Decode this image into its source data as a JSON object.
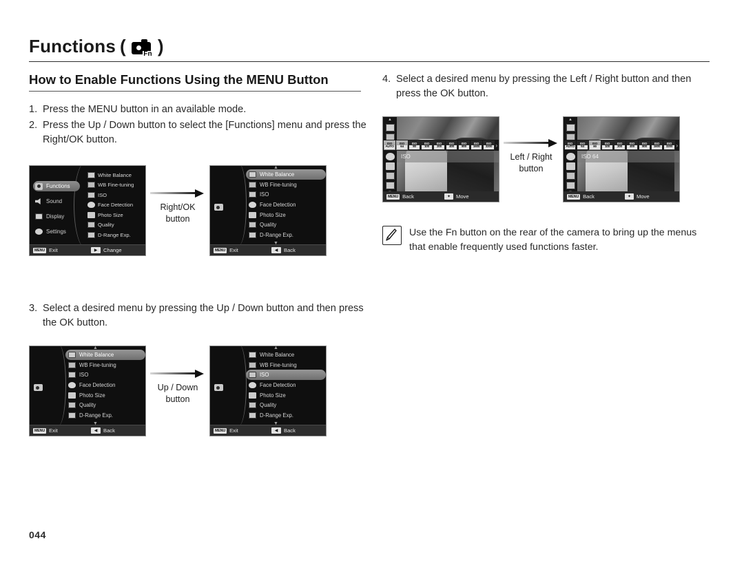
{
  "header": {
    "title": "Functions",
    "paren_open": "(",
    "paren_close": ")",
    "icon": "camera-fn-icon",
    "icon_label": "Fn"
  },
  "section": {
    "title": "How to Enable Functions Using the MENU Button"
  },
  "steps": {
    "s1_num": "1.",
    "s1_text": "Press the MENU button in an available mode.",
    "s2_num": "2.",
    "s2_text": "Press the Up / Down button to select the [Functions] menu and press the Right/OK button.",
    "s3_num": "3.",
    "s3_text": "Select a desired menu by pressing the Up / Down button and then press the OK button.",
    "s4_num": "4.",
    "s4_text": "Select a desired menu by pressing the Left / Right button and then press the OK button."
  },
  "connectors": {
    "c1_line1": "Right/OK",
    "c1_line2": "button",
    "c2_line1": "Up / Down",
    "c2_line2": "button",
    "c3_line1": "Left / Right",
    "c3_line2": "button"
  },
  "menu_categories": [
    {
      "label": "Functions",
      "icon": "camera-icon",
      "selected": true
    },
    {
      "label": "Sound",
      "icon": "speaker-icon",
      "selected": false
    },
    {
      "label": "Display",
      "icon": "display-icon",
      "selected": false
    },
    {
      "label": "Settings",
      "icon": "gear-icon",
      "selected": false
    }
  ],
  "function_items": [
    {
      "label": "White Balance",
      "icon": "white-balance-icon"
    },
    {
      "label": "WB Fine-tuning",
      "icon": "wb-fine-tuning-icon"
    },
    {
      "label": "ISO",
      "icon": "iso-icon"
    },
    {
      "label": "Face Detection",
      "icon": "face-detection-icon"
    },
    {
      "label": "Photo Size",
      "icon": "photo-size-icon"
    },
    {
      "label": "Quality",
      "icon": "quality-icon"
    },
    {
      "label": "D-Range Exp.",
      "icon": "d-range-icon"
    }
  ],
  "screens": {
    "s1": {
      "name": "main-menu-functions-selected",
      "selected_category": "Functions",
      "bottom_left_key": "MENU",
      "bottom_left_label": "Exit",
      "bottom_right_key": "OK",
      "bottom_right_label": "Change"
    },
    "s2": {
      "name": "functions-list-white-balance-selected",
      "selected_item": "White Balance",
      "bottom_left_key": "MENU",
      "bottom_left_label": "Exit",
      "bottom_right_key": "LEFT",
      "bottom_right_label": "Back"
    },
    "s3": {
      "name": "functions-list-white-balance-selected",
      "selected_item": "White Balance",
      "bottom_left_key": "MENU",
      "bottom_left_label": "Exit",
      "bottom_right_key": "LEFT",
      "bottom_right_label": "Back"
    },
    "s4": {
      "name": "functions-list-iso-selected",
      "selected_item": "ISO",
      "bottom_left_key": "MENU",
      "bottom_left_label": "Exit",
      "bottom_right_key": "LEFT",
      "bottom_right_label": "Back"
    },
    "s5": {
      "name": "live-view-iso-strip-unselected",
      "value_label": "ISO",
      "bottom_left_key": "MENU",
      "bottom_left_label": "Back",
      "bottom_right_key": "DPAD",
      "bottom_right_label": "Move"
    },
    "s6": {
      "name": "live-view-iso-strip-iso64-selected",
      "value_label": "ISO 64",
      "bottom_left_key": "MENU",
      "bottom_left_label": "Back",
      "bottom_right_key": "DPAD",
      "bottom_right_label": "Move"
    }
  },
  "iso_strip": {
    "prefix": "ISO",
    "more_glyph": "›",
    "options": [
      {
        "label": "ISO",
        "value": "AUTO"
      },
      {
        "label": "ISO",
        "value": "64"
      },
      {
        "label": "ISO",
        "value": "80"
      },
      {
        "label": "ISO",
        "value": "100"
      },
      {
        "label": "ISO",
        "value": "200"
      },
      {
        "label": "ISO",
        "value": "400"
      },
      {
        "label": "ISO",
        "value": "800"
      },
      {
        "label": "ISO",
        "value": "1600"
      },
      {
        "label": "ISO",
        "value": "3200"
      }
    ],
    "selected_index_left": 0,
    "selected_index_right": 1
  },
  "note": {
    "icon": "pencil-note-icon",
    "text": "Use the Fn button on the rear of the camera to bring up the menus that enable frequently used functions faster."
  },
  "footer": {
    "page_number": "044"
  }
}
